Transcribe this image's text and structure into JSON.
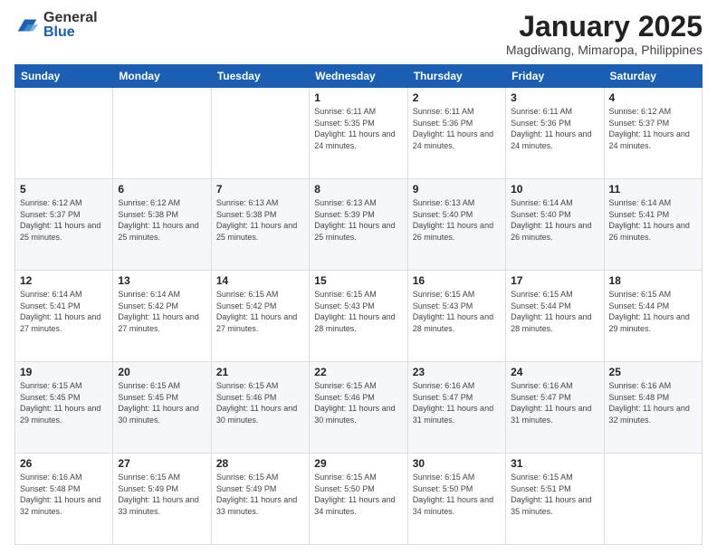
{
  "logo": {
    "general": "General",
    "blue": "Blue"
  },
  "title": "January 2025",
  "subtitle": "Magdiwang, Mimaropa, Philippines",
  "weekdays": [
    "Sunday",
    "Monday",
    "Tuesday",
    "Wednesday",
    "Thursday",
    "Friday",
    "Saturday"
  ],
  "weeks": [
    [
      {
        "day": "",
        "sunrise": "",
        "sunset": "",
        "daylight": ""
      },
      {
        "day": "",
        "sunrise": "",
        "sunset": "",
        "daylight": ""
      },
      {
        "day": "",
        "sunrise": "",
        "sunset": "",
        "daylight": ""
      },
      {
        "day": "1",
        "sunrise": "Sunrise: 6:11 AM",
        "sunset": "Sunset: 5:35 PM",
        "daylight": "Daylight: 11 hours and 24 minutes."
      },
      {
        "day": "2",
        "sunrise": "Sunrise: 6:11 AM",
        "sunset": "Sunset: 5:36 PM",
        "daylight": "Daylight: 11 hours and 24 minutes."
      },
      {
        "day": "3",
        "sunrise": "Sunrise: 6:11 AM",
        "sunset": "Sunset: 5:36 PM",
        "daylight": "Daylight: 11 hours and 24 minutes."
      },
      {
        "day": "4",
        "sunrise": "Sunrise: 6:12 AM",
        "sunset": "Sunset: 5:37 PM",
        "daylight": "Daylight: 11 hours and 24 minutes."
      }
    ],
    [
      {
        "day": "5",
        "sunrise": "Sunrise: 6:12 AM",
        "sunset": "Sunset: 5:37 PM",
        "daylight": "Daylight: 11 hours and 25 minutes."
      },
      {
        "day": "6",
        "sunrise": "Sunrise: 6:12 AM",
        "sunset": "Sunset: 5:38 PM",
        "daylight": "Daylight: 11 hours and 25 minutes."
      },
      {
        "day": "7",
        "sunrise": "Sunrise: 6:13 AM",
        "sunset": "Sunset: 5:38 PM",
        "daylight": "Daylight: 11 hours and 25 minutes."
      },
      {
        "day": "8",
        "sunrise": "Sunrise: 6:13 AM",
        "sunset": "Sunset: 5:39 PM",
        "daylight": "Daylight: 11 hours and 25 minutes."
      },
      {
        "day": "9",
        "sunrise": "Sunrise: 6:13 AM",
        "sunset": "Sunset: 5:40 PM",
        "daylight": "Daylight: 11 hours and 26 minutes."
      },
      {
        "day": "10",
        "sunrise": "Sunrise: 6:14 AM",
        "sunset": "Sunset: 5:40 PM",
        "daylight": "Daylight: 11 hours and 26 minutes."
      },
      {
        "day": "11",
        "sunrise": "Sunrise: 6:14 AM",
        "sunset": "Sunset: 5:41 PM",
        "daylight": "Daylight: 11 hours and 26 minutes."
      }
    ],
    [
      {
        "day": "12",
        "sunrise": "Sunrise: 6:14 AM",
        "sunset": "Sunset: 5:41 PM",
        "daylight": "Daylight: 11 hours and 27 minutes."
      },
      {
        "day": "13",
        "sunrise": "Sunrise: 6:14 AM",
        "sunset": "Sunset: 5:42 PM",
        "daylight": "Daylight: 11 hours and 27 minutes."
      },
      {
        "day": "14",
        "sunrise": "Sunrise: 6:15 AM",
        "sunset": "Sunset: 5:42 PM",
        "daylight": "Daylight: 11 hours and 27 minutes."
      },
      {
        "day": "15",
        "sunrise": "Sunrise: 6:15 AM",
        "sunset": "Sunset: 5:43 PM",
        "daylight": "Daylight: 11 hours and 28 minutes."
      },
      {
        "day": "16",
        "sunrise": "Sunrise: 6:15 AM",
        "sunset": "Sunset: 5:43 PM",
        "daylight": "Daylight: 11 hours and 28 minutes."
      },
      {
        "day": "17",
        "sunrise": "Sunrise: 6:15 AM",
        "sunset": "Sunset: 5:44 PM",
        "daylight": "Daylight: 11 hours and 28 minutes."
      },
      {
        "day": "18",
        "sunrise": "Sunrise: 6:15 AM",
        "sunset": "Sunset: 5:44 PM",
        "daylight": "Daylight: 11 hours and 29 minutes."
      }
    ],
    [
      {
        "day": "19",
        "sunrise": "Sunrise: 6:15 AM",
        "sunset": "Sunset: 5:45 PM",
        "daylight": "Daylight: 11 hours and 29 minutes."
      },
      {
        "day": "20",
        "sunrise": "Sunrise: 6:15 AM",
        "sunset": "Sunset: 5:45 PM",
        "daylight": "Daylight: 11 hours and 30 minutes."
      },
      {
        "day": "21",
        "sunrise": "Sunrise: 6:15 AM",
        "sunset": "Sunset: 5:46 PM",
        "daylight": "Daylight: 11 hours and 30 minutes."
      },
      {
        "day": "22",
        "sunrise": "Sunrise: 6:15 AM",
        "sunset": "Sunset: 5:46 PM",
        "daylight": "Daylight: 11 hours and 30 minutes."
      },
      {
        "day": "23",
        "sunrise": "Sunrise: 6:16 AM",
        "sunset": "Sunset: 5:47 PM",
        "daylight": "Daylight: 11 hours and 31 minutes."
      },
      {
        "day": "24",
        "sunrise": "Sunrise: 6:16 AM",
        "sunset": "Sunset: 5:47 PM",
        "daylight": "Daylight: 11 hours and 31 minutes."
      },
      {
        "day": "25",
        "sunrise": "Sunrise: 6:16 AM",
        "sunset": "Sunset: 5:48 PM",
        "daylight": "Daylight: 11 hours and 32 minutes."
      }
    ],
    [
      {
        "day": "26",
        "sunrise": "Sunrise: 6:16 AM",
        "sunset": "Sunset: 5:48 PM",
        "daylight": "Daylight: 11 hours and 32 minutes."
      },
      {
        "day": "27",
        "sunrise": "Sunrise: 6:15 AM",
        "sunset": "Sunset: 5:49 PM",
        "daylight": "Daylight: 11 hours and 33 minutes."
      },
      {
        "day": "28",
        "sunrise": "Sunrise: 6:15 AM",
        "sunset": "Sunset: 5:49 PM",
        "daylight": "Daylight: 11 hours and 33 minutes."
      },
      {
        "day": "29",
        "sunrise": "Sunrise: 6:15 AM",
        "sunset": "Sunset: 5:50 PM",
        "daylight": "Daylight: 11 hours and 34 minutes."
      },
      {
        "day": "30",
        "sunrise": "Sunrise: 6:15 AM",
        "sunset": "Sunset: 5:50 PM",
        "daylight": "Daylight: 11 hours and 34 minutes."
      },
      {
        "day": "31",
        "sunrise": "Sunrise: 6:15 AM",
        "sunset": "Sunset: 5:51 PM",
        "daylight": "Daylight: 11 hours and 35 minutes."
      },
      {
        "day": "",
        "sunrise": "",
        "sunset": "",
        "daylight": ""
      }
    ]
  ]
}
